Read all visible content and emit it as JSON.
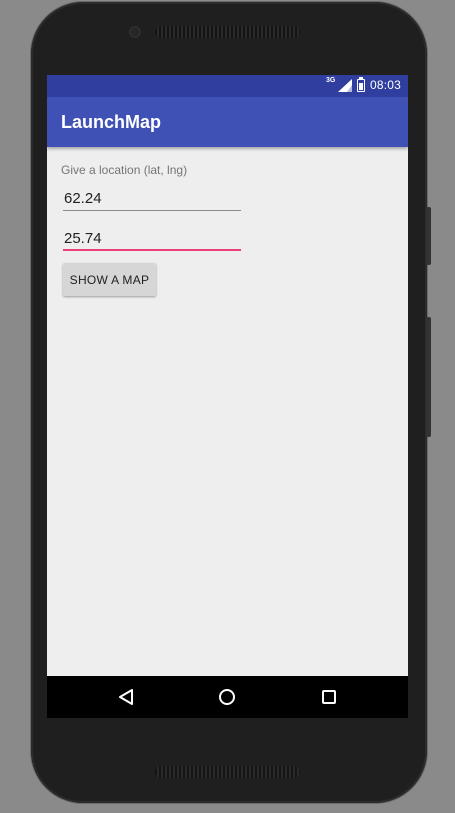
{
  "status_bar": {
    "network_label": "3G",
    "time": "08:03",
    "icons": [
      "signal-icon",
      "battery-icon"
    ]
  },
  "app_bar": {
    "title": "LaunchMap"
  },
  "form": {
    "prompt": "Give a location (lat, lng)",
    "latitude_value": "62.24",
    "longitude_value": "25.74",
    "button_label": "SHOW A MAP"
  },
  "nav_bar": {
    "icons": [
      "back-icon",
      "home-icon",
      "recents-icon"
    ]
  },
  "colors": {
    "status_bar": "#303f9f",
    "app_bar": "#3f51b5",
    "accent": "#ec407a",
    "background": "#eeeeee"
  }
}
